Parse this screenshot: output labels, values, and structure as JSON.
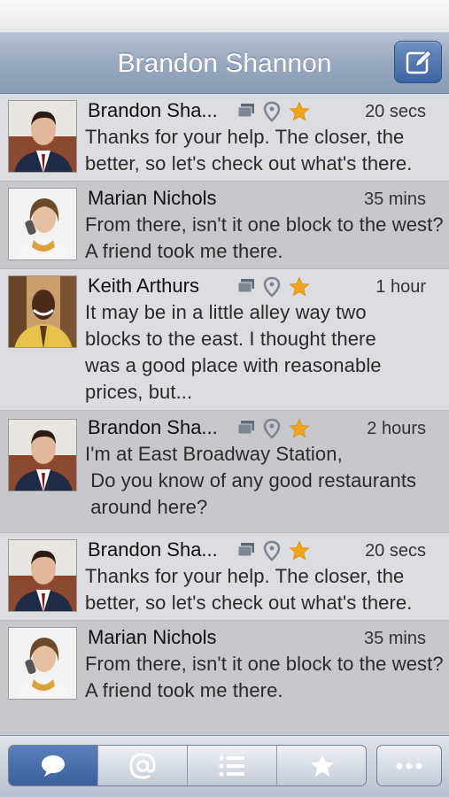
{
  "nav": {
    "title": "Brandon Shannon"
  },
  "messages": [
    {
      "name": "Brandon Sha...",
      "time": "20 secs",
      "text": "Thanks for your help. The closer, the better, so let's check out what's there.",
      "avatar": "man-suit",
      "icons": true
    },
    {
      "name": "Marian Nichols",
      "time": "35 mins",
      "text": "From there, isn't it one block to the west? A friend took me there.",
      "avatar": "woman-phone",
      "icons": false
    },
    {
      "name": "Keith Arthurs",
      "time": "1 hour",
      "text": "It may be in a little alley way two blocks to the east. I thought there was a good place with reasonable prices, but...",
      "avatar": "man-yellow",
      "icons": true
    },
    {
      "name": "Brandon Sha...",
      "time": "2 hours",
      "text": "I'm at East Broadway Station,\n Do you know of any good restaurants\n around here?",
      "avatar": "man-suit",
      "icons": true
    },
    {
      "name": "Brandon Sha...",
      "time": "20 secs",
      "text": "Thanks for your help. The closer, the better, so let's check out what's there.",
      "avatar": "man-suit",
      "icons": true
    },
    {
      "name": "Marian Nichols",
      "time": "35 mins",
      "text": "From there, isn't it one block to the west? A friend took me there.",
      "avatar": "woman-phone",
      "icons": false
    }
  ],
  "tabbar": {
    "tabs": [
      "chat-bubble-icon",
      "at-sign-icon",
      "list-icon",
      "star-icon"
    ],
    "active": "chat-bubble-icon",
    "more": "ellipsis-icon"
  },
  "colors": {
    "accent": "#3d63a2",
    "star": "#f2a51a",
    "icon_gray": "#7c8593"
  }
}
